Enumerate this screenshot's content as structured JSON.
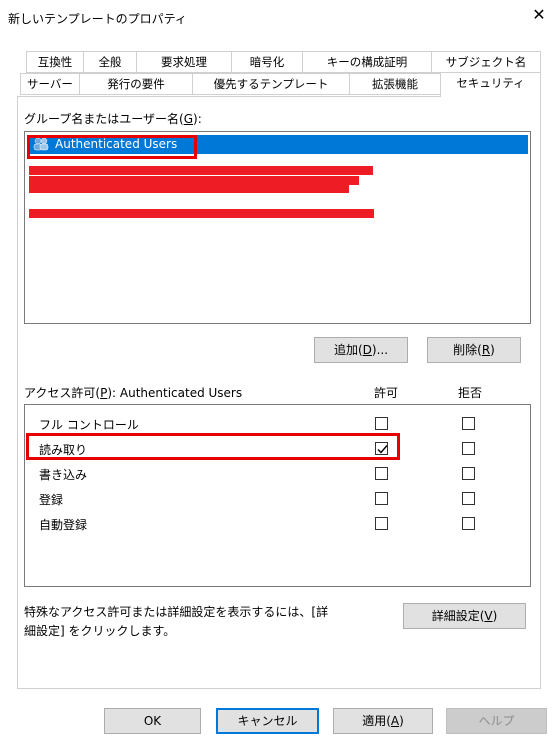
{
  "window": {
    "title": "新しいテンプレートのプロパティ",
    "close_label": "✕"
  },
  "tabs_row1": [
    "互換性",
    "全般",
    "要求処理",
    "暗号化",
    "キーの構成証明",
    "サブジェクト名"
  ],
  "tabs_row2": [
    "サーバー",
    "発行の要件",
    "優先するテンプレート",
    "拡張機能",
    "セキュリティ"
  ],
  "selected_tab": "セキュリティ",
  "groups": {
    "label": "グループ名またはユーザー名(",
    "label_key": "G",
    "label_end": "):",
    "selected_user": "Authenticated Users"
  },
  "buttons": {
    "add_label": "追加(",
    "add_key": "D",
    "add_end": ")...",
    "remove_label": "削除(",
    "remove_key": "R",
    "remove_end": ")",
    "advanced_label": "詳細設定(",
    "advanced_key": "V",
    "advanced_end": ")",
    "ok": "OK",
    "cancel": "キャンセル",
    "apply_label": "適用(",
    "apply_key": "A",
    "apply_end": ")",
    "help": "ヘルプ"
  },
  "permissions": {
    "header_label": "アクセス許可(",
    "header_key": "P",
    "header_end": "): Authenticated Users",
    "allow_header": "許可",
    "deny_header": "拒否",
    "rows": [
      {
        "name": "フル コントロール",
        "allow": false,
        "deny": false
      },
      {
        "name": "読み取り",
        "allow": true,
        "deny": false
      },
      {
        "name": "書き込み",
        "allow": false,
        "deny": false
      },
      {
        "name": "登録",
        "allow": false,
        "deny": false
      },
      {
        "name": "自動登録",
        "allow": false,
        "deny": false
      }
    ]
  },
  "advanced_note": {
    "line1": "特殊なアクセス許可または詳細設定を表示するには、[詳",
    "line2": "細設定] をクリックします。"
  },
  "colors": {
    "selection": "#0078d7",
    "highlight_box": "#e60000",
    "redaction": "#ee1c25"
  }
}
